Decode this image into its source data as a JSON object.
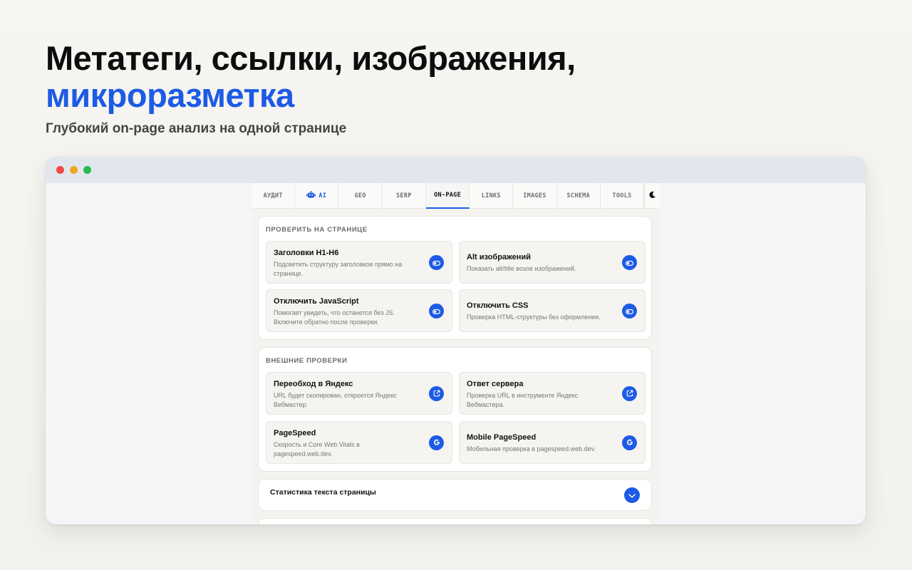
{
  "hero": {
    "title_line1": "Метатеги, ссылки, изображения,",
    "title_line2": "микроразметка",
    "subtitle": "Глубокий on-page анализ на одной странице"
  },
  "tabs": [
    {
      "label": "АУДИТ",
      "icon": null
    },
    {
      "label": "AI",
      "icon": "robot-icon"
    },
    {
      "label": "GEO",
      "icon": null
    },
    {
      "label": "SERP",
      "icon": null
    },
    {
      "label": "ON-PAGE",
      "icon": null,
      "active": true
    },
    {
      "label": "LINKS",
      "icon": null
    },
    {
      "label": "IMAGES",
      "icon": null
    },
    {
      "label": "SCHEMA",
      "icon": null
    },
    {
      "label": "TOOLS",
      "icon": null
    }
  ],
  "theme_toggle_icon": "moon-icon",
  "sections": [
    {
      "title": "ПРОВЕРИТЬ НА СТРАНИЦЕ",
      "items": [
        {
          "title": "Заголовки H1-H6",
          "desc": "Подсветить структуру заголовков прямо на странице.",
          "icon": "toggle-icon"
        },
        {
          "title": "Alt изображений",
          "desc": "Показать alt/title возле изображений.",
          "icon": "toggle-icon"
        },
        {
          "title": "Отключить JavaScript",
          "desc": "Помогает увидеть, что останется без JS. Включите обратно после проверки.",
          "icon": "toggle-icon"
        },
        {
          "title": "Отключить CSS",
          "desc": "Проверка HTML-структуры без оформления.",
          "icon": "toggle-icon"
        }
      ]
    },
    {
      "title": "ВНЕШНИЕ ПРОВЕРКИ",
      "items": [
        {
          "title": "Переобход в Яндекс",
          "desc": "URL будет скопирован, откроется Яндекс Вебмастер.",
          "icon": "external-link-icon"
        },
        {
          "title": "Ответ сервера",
          "desc": "Проверка URL в инструменте Яндекс Вебмастера.",
          "icon": "external-link-icon"
        },
        {
          "title": "PageSpeed",
          "desc": "Скорость и Core Web Vitals в pagespeed.web.dev.",
          "icon": "google-icon"
        },
        {
          "title": "Mobile PageSpeed",
          "desc": "Мобильная проверка в pagespeed.web.dev.",
          "icon": "google-icon"
        }
      ]
    }
  ],
  "stats": {
    "title": "Статистика текста страницы",
    "icon": "chevron-down-icon"
  },
  "colors": {
    "accent": "#1d5be6",
    "background": "#f5f4f0"
  }
}
